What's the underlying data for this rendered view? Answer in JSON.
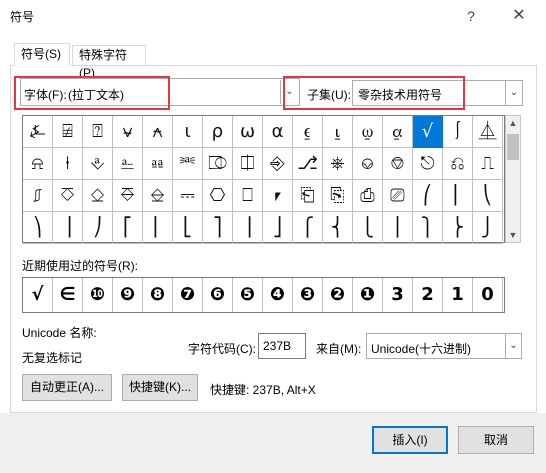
{
  "window": {
    "title": "符号",
    "help_label": "?",
    "close_label": "✕"
  },
  "tabs": [
    {
      "label": "符号(S)"
    },
    {
      "label": "特殊字符(P)"
    }
  ],
  "font": {
    "label": "字体(F):",
    "value": "(拉丁文本)",
    "dropdown_icon": "⌄"
  },
  "subset": {
    "label": "子集(U):",
    "value": "零杂技术用符号",
    "dropdown_icon": "⌄"
  },
  "symbols": {
    "rows": [
      [
        "⍼",
        "⍯",
        "⍰",
        "⍱",
        "⍲",
        "⍳",
        "⍴",
        "⍵",
        "⍺",
        "⍷",
        "⍸",
        "⍹",
        "⍶",
        "√",
        "⎰",
        "⏅"
      ],
      [
        "⍾",
        "⍿",
        "⎀",
        "⎁",
        "⎂",
        "⎃",
        "⎄",
        "⎅",
        "⎆",
        "⎇",
        "⎈",
        "⎉",
        "⎊",
        "⎋",
        "⎌",
        "⎍"
      ],
      [
        "⎎",
        "⎏",
        "⎐",
        "⎑",
        "⎒",
        "⎓",
        "⎔",
        "⎕",
        "⎖",
        "⎗",
        "⎘",
        "⎙",
        "⎚",
        "⎛",
        "⎜",
        "⎝"
      ],
      [
        "⎞",
        "⎟",
        "⎠",
        "⎡",
        "⎢",
        "⎣",
        "⎤",
        "⎥",
        "⎦",
        "⎧",
        "⎨",
        "⎩",
        "⎪",
        "⎫",
        "⎬",
        "⎭"
      ]
    ],
    "selected": "√"
  },
  "recent": {
    "label": "近期使用过的符号(R):",
    "items": [
      "√",
      "∈",
      "❿",
      "❾",
      "❽",
      "❼",
      "❻",
      "❺",
      "❹",
      "❸",
      "❷",
      "❶",
      "3",
      "2",
      "1",
      "0"
    ]
  },
  "unicode": {
    "name_label": "Unicode 名称:",
    "name_value": "无复选标记",
    "code_label": "字符代码(C):",
    "code_value": "237B",
    "from_label": "来自(M):",
    "from_value": "Unicode(十六进制)"
  },
  "buttons": {
    "autocorrect": "自动更正(A)...",
    "shortcut": "快捷键(K)...",
    "shortcut_text": "快捷键: 237B, Alt+X",
    "insert": "插入(I)",
    "cancel": "取消"
  },
  "colors": {
    "highlight_box": "#e3383f",
    "selection": "#0078d7"
  }
}
